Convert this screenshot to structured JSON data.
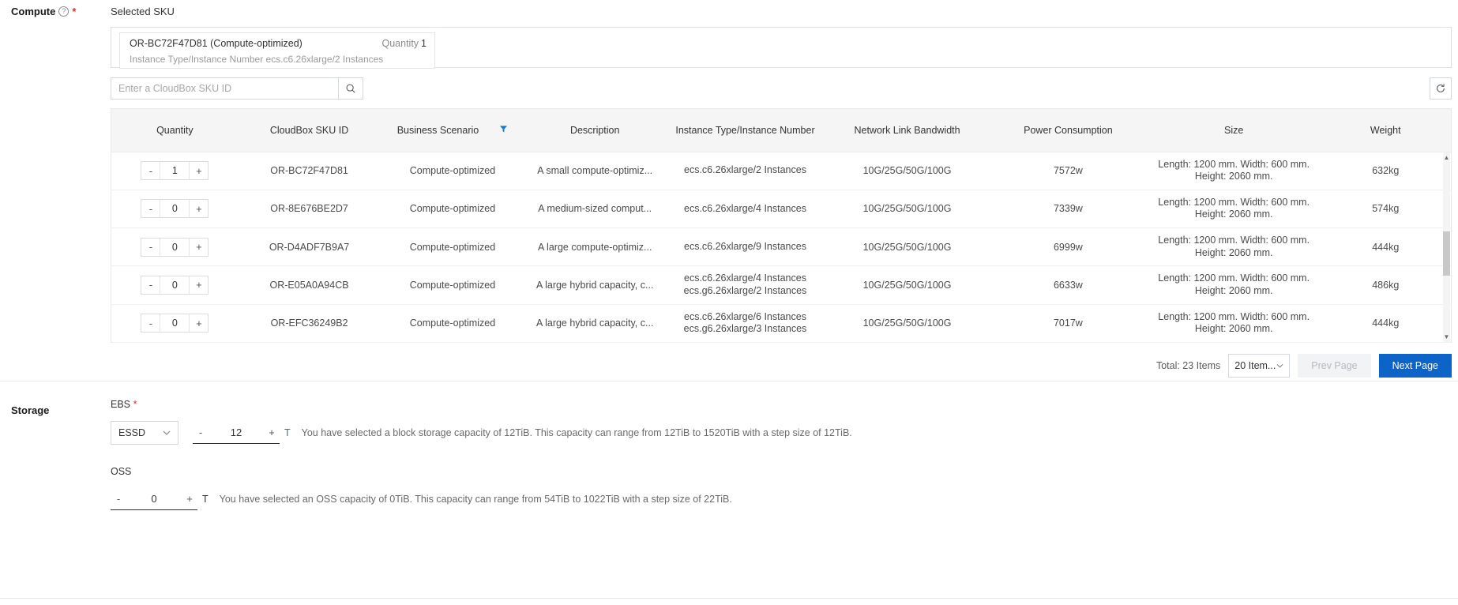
{
  "compute": {
    "label": "Compute",
    "required_mark": "*",
    "help_icon": "?",
    "selected_sku_label": "Selected SKU",
    "selected_card": {
      "title": "OR-BC72F47D81 (Compute-optimized)",
      "quantity_label": "Quantity",
      "quantity_value": "1",
      "subtitle": "Instance Type/Instance Number ecs.c6.26xlarge/2 Instances"
    },
    "search": {
      "placeholder": "Enter a CloudBox SKU ID",
      "value": "",
      "search_icon": "search-icon",
      "refresh_icon": "refresh-icon"
    },
    "table": {
      "columns": [
        "Quantity",
        "CloudBox SKU ID",
        "Business Scenario",
        "Description",
        "Instance Type/Instance Number",
        "Network Link Bandwidth",
        "Power Consumption",
        "Size",
        "Weight"
      ],
      "filter_icon": "filter-icon",
      "rows": [
        {
          "quantity": "1",
          "sku_id": "OR-BC72F47D81",
          "scenario": "Compute-optimized",
          "description": "A small compute-optimiz...",
          "instance": "ecs.c6.26xlarge/2 Instances",
          "bandwidth": "10G/25G/50G/100G",
          "power": "7572w",
          "size": "Length: 1200 mm. Width: 600 mm. Height: 2060 mm.",
          "weight": "632kg"
        },
        {
          "quantity": "0",
          "sku_id": "OR-8E676BE2D7",
          "scenario": "Compute-optimized",
          "description": "A medium-sized comput...",
          "instance": "ecs.c6.26xlarge/4 Instances",
          "bandwidth": "10G/25G/50G/100G",
          "power": "7339w",
          "size": "Length: 1200 mm. Width: 600 mm. Height: 2060 mm.",
          "weight": "574kg"
        },
        {
          "quantity": "0",
          "sku_id": "OR-D4ADF7B9A7",
          "scenario": "Compute-optimized",
          "description": "A large compute-optimiz...",
          "instance": "ecs.c6.26xlarge/9 Instances",
          "bandwidth": "10G/25G/50G/100G",
          "power": "6999w",
          "size": "Length: 1200 mm. Width: 600 mm. Height: 2060 mm.",
          "weight": "444kg"
        },
        {
          "quantity": "0",
          "sku_id": "OR-E05A0A94CB",
          "scenario": "Compute-optimized",
          "description": "A large hybrid capacity, c...",
          "instance": "ecs.c6.26xlarge/4 Instances\necs.g6.26xlarge/2 Instances",
          "bandwidth": "10G/25G/50G/100G",
          "power": "6633w",
          "size": "Length: 1200 mm. Width: 600 mm. Height: 2060 mm.",
          "weight": "486kg"
        },
        {
          "quantity": "0",
          "sku_id": "OR-EFC36249B2",
          "scenario": "Compute-optimized",
          "description": "A large hybrid capacity, c...",
          "instance": "ecs.c6.26xlarge/6 Instances\necs.g6.26xlarge/3 Instances",
          "bandwidth": "10G/25G/50G/100G",
          "power": "7017w",
          "size": "Length: 1200 mm. Width: 600 mm. Height: 2060 mm.",
          "weight": "444kg"
        }
      ]
    },
    "pagination": {
      "total": "Total: 23 Items",
      "page_size": "20 Item...",
      "prev_label": "Prev Page",
      "next_label": "Next Page"
    }
  },
  "storage": {
    "label": "Storage",
    "ebs": {
      "label": "EBS",
      "required_mark": "*",
      "type_value": "ESSD",
      "minus": "-",
      "plus": "+",
      "value": "12",
      "unit": "T",
      "hint": "You have selected a block storage capacity of 12TiB. This capacity can range from 12TiB to 1520TiB with a step size of 12TiB."
    },
    "oss": {
      "label": "OSS",
      "minus": "-",
      "plus": "+",
      "value": "0",
      "unit": "T",
      "hint": "You have selected an OSS capacity of 0TiB. This capacity can range from 54TiB to 1022TiB with a step size of 22TiB."
    }
  },
  "colors": {
    "accent": "#0c64c8",
    "required": "#d93026",
    "filter": "#1677d2",
    "link": "#2a6fc4"
  }
}
